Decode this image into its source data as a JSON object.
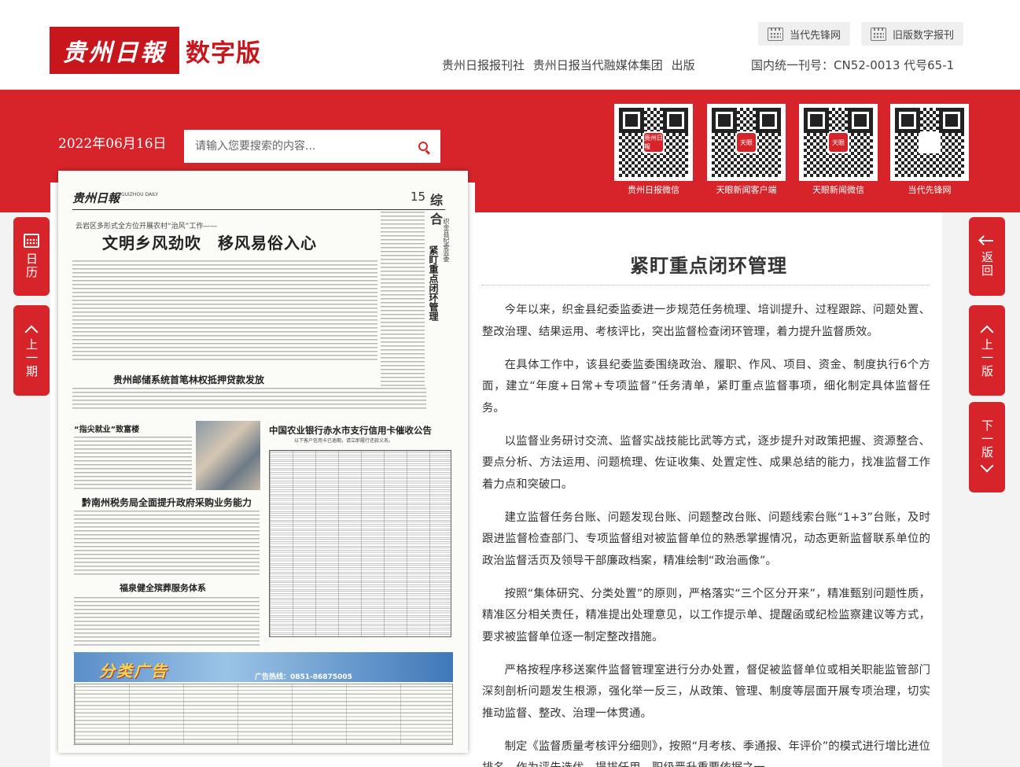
{
  "header": {
    "logo_mark": "贵州日報",
    "logo_sub": "数字版",
    "links": {
      "xianfeng": "当代先锋网",
      "old_edition": "旧版数字报刊"
    },
    "publisher": [
      "贵州日报报刊社",
      "贵州日报当代融媒体集团",
      "出版"
    ],
    "serial": "国内统一刊号：CN52-0013 代号65-1"
  },
  "toolbar": {
    "date": "2022年06月16日",
    "search_placeholder": "请输入您要搜索的内容..."
  },
  "qr_codes": [
    {
      "caption": "贵州日报微信",
      "logo": "贵州日報"
    },
    {
      "caption": "天眼新闻客户端",
      "logo": "天眼"
    },
    {
      "caption": "天眼新闻微信",
      "logo": "天眼"
    },
    {
      "caption": "当代先锋网",
      "logo": ""
    }
  ],
  "side_nav": {
    "calendar": "日历",
    "prev_issue": "上一期",
    "back": "返回",
    "prev_page": "上一版",
    "next_page": "下一版"
  },
  "newspaper": {
    "logo": "贵州日報",
    "logo_en": "GUIZHOU DAILY",
    "page_no": "15",
    "section": "综合",
    "kicker1": "云岩区多形式全方位开展农村“治风”工作——",
    "headline1": "文明乡风劲吹　移风易俗入心",
    "right_kicker": "织金县纪委监委",
    "right_title": "紧盯重点闭环管理",
    "headline2": "贵州邮储系统首笔林权抵押贷款发放",
    "small_head": "“指尖就业”致富楼",
    "headline3": "黔南州税务局全面提升政府采购业务能力",
    "headline4": "福泉健全殡葬服务体系",
    "bank_title": "中国农业银行赤水市支行信用卡催收公告",
    "bank_sub": "以下客户信用卡已逾期，请立即履行还款义务。",
    "ad_title": "分类广告",
    "ad_phone": "广告热线：0851-86875005"
  },
  "article": {
    "title": "紧盯重点闭环管理",
    "paragraphs": [
      "今年以来，织金县纪委监委进一步规范任务梳理、培训提升、过程跟踪、问题处置、整改治理、结果运用、考核评比，突出监督检查闭环管理，着力提升监督质效。",
      "在具体工作中，该县纪委监委围绕政治、履职、作风、项目、资金、制度执行6个方面，建立“年度+日常+专项监督”任务清单，紧盯重点监督事项，细化制定具体监督任务。",
      "以监督业务研讨交流、监督实战技能比武等方式，逐步提升对政策把握、资源整合、要点分析、方法运用、问题梳理、佐证收集、处置定性、成果总结的能力，找准监督工作着力点和突破口。",
      "建立监督任务台账、问题发现台账、问题整改台账、问题线索台账“1+3”台账，及时跟进监督检查部门、专项监督组对被监督单位的熟悉掌握情况，动态更新监督联系单位的政治监督活页及领导干部廉政档案，精准绘制“政治画像”。",
      "按照“集体研究、分类处置”的原则，严格落实“三个区分开来”，精准甄别问题性质，精准区分相关责任，精准提出处理意见，以工作提示单、提醒函或纪检监察建议等方式，要求被监督单位逐一制定整改措施。",
      "严格按程序移送案件监督管理室进行分办处置，督促被监督单位或相关职能监管部门深刻剖析问题发生根源，强化举一反三，从政策、管理、制度等层面开展专项治理，切实推动监督、整改、治理一体贯通。",
      "制定《监督质量考核评分细则》，按照“月考核、季通报、年评价”的模式进行增比进位排名，作为评先选优、提拔任用、职级晋升重要依据之一。"
    ]
  }
}
